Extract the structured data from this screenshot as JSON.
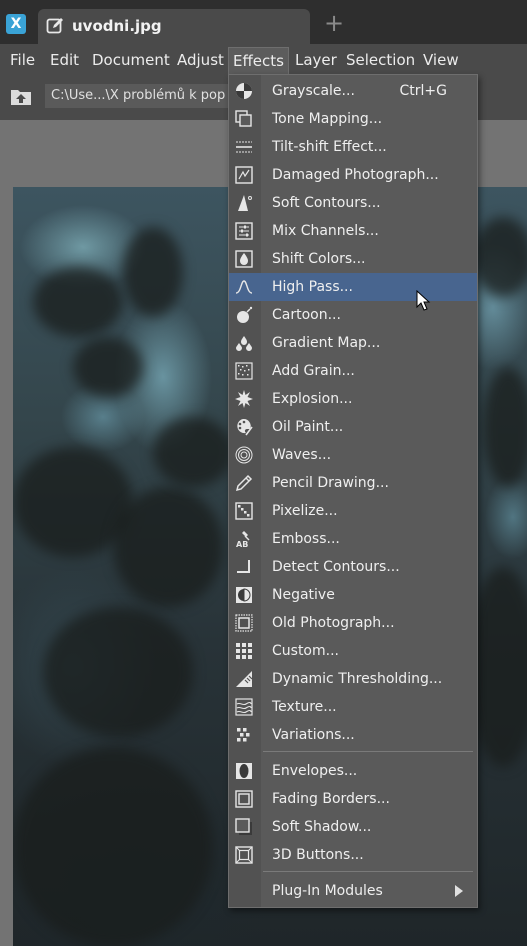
{
  "colors": {
    "highlight": "#48658f",
    "menu_bg": "#5a5a5a",
    "titlebar": "#2e2e2e",
    "app_icon": "#3aa3d6"
  },
  "titlebar": {
    "app_icon_glyph": "X",
    "tab_title": "uvodni.jpg",
    "tab_icon": "edit-icon",
    "new_tab_glyph": "+"
  },
  "menubar": {
    "items": [
      {
        "label": "File"
      },
      {
        "label": "Edit"
      },
      {
        "label": "Document"
      },
      {
        "label": "Adjust"
      },
      {
        "label": "Effects"
      },
      {
        "label": "Layer"
      },
      {
        "label": "Selection"
      },
      {
        "label": "View"
      }
    ]
  },
  "toolbar": {
    "path": "C:\\Use...\\X problémů k pop"
  },
  "effects_menu": {
    "items": [
      {
        "label": "Grayscale...",
        "shortcut": "Ctrl+G",
        "icon": "grayscale-icon"
      },
      {
        "label": "Tone Mapping...",
        "icon": "tone-mapping-icon"
      },
      {
        "label": "Tilt-shift Effect...",
        "icon": "tilt-shift-icon"
      },
      {
        "label": "Damaged Photograph...",
        "icon": "damaged-photo-icon"
      },
      {
        "label": "Soft Contours...",
        "icon": "soft-contours-icon"
      },
      {
        "label": "Mix Channels...",
        "icon": "mix-channels-icon"
      },
      {
        "label": "Shift Colors...",
        "icon": "shift-colors-icon"
      },
      {
        "label": "High Pass...",
        "icon": "high-pass-icon",
        "highlighted": true
      },
      {
        "label": "Cartoon...",
        "icon": "cartoon-icon"
      },
      {
        "label": "Gradient Map...",
        "icon": "gradient-map-icon"
      },
      {
        "label": "Add Grain...",
        "icon": "add-grain-icon"
      },
      {
        "label": "Explosion...",
        "icon": "explosion-icon"
      },
      {
        "label": "Oil Paint...",
        "icon": "oil-paint-icon"
      },
      {
        "label": "Waves...",
        "icon": "waves-icon"
      },
      {
        "label": "Pencil Drawing...",
        "icon": "pencil-icon"
      },
      {
        "label": "Pixelize...",
        "icon": "pixelize-icon"
      },
      {
        "label": "Emboss...",
        "icon": "emboss-icon"
      },
      {
        "label": "Detect Contours...",
        "icon": "detect-contours-icon"
      },
      {
        "label": "Negative",
        "icon": "negative-icon"
      },
      {
        "label": "Old Photograph...",
        "icon": "old-photo-icon"
      },
      {
        "label": "Custom...",
        "icon": "custom-grid-icon"
      },
      {
        "label": "Dynamic Thresholding...",
        "icon": "dynamic-threshold-icon"
      },
      {
        "label": "Texture...",
        "icon": "texture-icon"
      },
      {
        "label": "Variations...",
        "icon": "variations-icon"
      },
      {
        "label": "Envelopes...",
        "icon": "envelope-icon"
      },
      {
        "label": "Fading Borders...",
        "icon": "fading-borders-icon"
      },
      {
        "label": "Soft Shadow...",
        "icon": "soft-shadow-icon"
      },
      {
        "label": "3D Buttons...",
        "icon": "3d-buttons-icon"
      },
      {
        "label": "Plug-In Modules",
        "icon": "",
        "submenu": true
      }
    ]
  }
}
